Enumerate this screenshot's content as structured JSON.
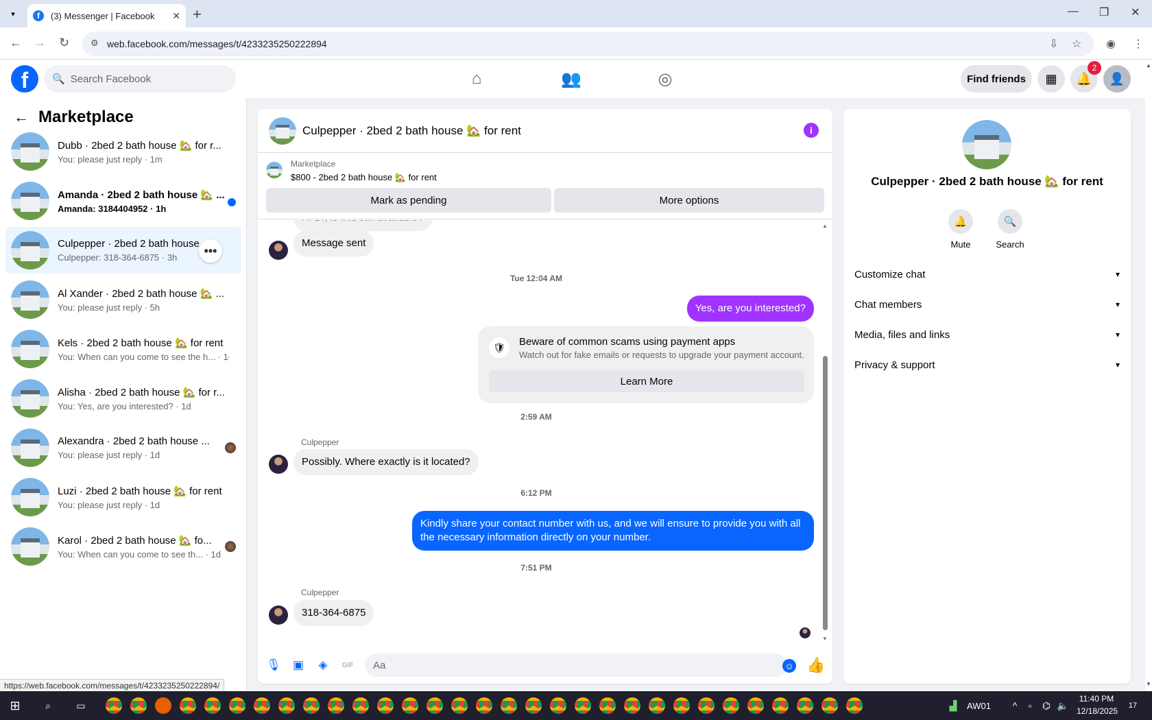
{
  "browser": {
    "tab_title": "(3) Messenger | Facebook",
    "url": "web.facebook.com/messages/t/4233235250222894",
    "status_url": "https://web.facebook.com/messages/t/4233235250222894/"
  },
  "header": {
    "search_placeholder": "Search Facebook",
    "find_friends": "Find friends",
    "notification_count": "2"
  },
  "left": {
    "title": "Marketplace",
    "conversations": [
      {
        "name": "Dubb · 2bed 2 bath house 🏡 for r...",
        "snippet": "You: please just reply · 1m"
      },
      {
        "name": "Amanda · 2bed 2 bath house 🏡 ...",
        "snippet": "Amanda: 3184404952 · 1h"
      },
      {
        "name": "Culpepper · 2bed 2 bath house ...",
        "snippet": "Culpepper: 318-364-6875 · 3h"
      },
      {
        "name": "Al Xander · 2bed 2 bath house 🏡 ...",
        "snippet": "You: please just reply · 5h"
      },
      {
        "name": "Kels · 2bed 2 bath house 🏡 for rent",
        "snippet": "You: When can you come to see the h... · 1d"
      },
      {
        "name": "Alisha · 2bed 2 bath house 🏡 for r...",
        "snippet": "You: Yes, are you interested? · 1d"
      },
      {
        "name": "Alexandra · 2bed 2 bath house ...",
        "snippet": "You: please just reply · 1d"
      },
      {
        "name": "Luzi · 2bed 2 bath house 🏡 for rent",
        "snippet": "You: please just reply · 1d"
      },
      {
        "name": "Karol · 2bed 2 bath house 🏡 fo...",
        "snippet": "You: When can you come to see th... · 1d"
      }
    ]
  },
  "chat": {
    "title": "Culpepper · 2bed 2 bath house 🏡 for rent",
    "marketplace_label": "Marketplace",
    "listing": "$800 - 2bed 2 bath house 🏡 for rent",
    "mark_pending": "Mark as pending",
    "more_options": "More options",
    "cut_off_msg": "Hi Dr, is this still available?",
    "msg_sent": "Message sent",
    "ts1": "Tue 12:04 AM",
    "out1": "Yes, are you interested?",
    "scam_title": "Beware of common scams using payment apps",
    "scam_sub": "Watch out for fake emails or requests to upgrade your payment account.",
    "learn_more": "Learn More",
    "ts2": "2:59 AM",
    "sender": "Culpepper",
    "in1": "Possibly. Where exactly is it located?",
    "ts3": "6:12 PM",
    "out2": "Kindly share your contact number with us, and we will ensure to provide you with all the necessary information directly on your number.",
    "ts4": "7:51 PM",
    "in2": "318-364-6875",
    "composer_placeholder": "Aa"
  },
  "info": {
    "title": "Culpepper · 2bed 2 bath house 🏡 for rent",
    "mute": "Mute",
    "search": "Search",
    "rows": [
      "Customize chat",
      "Chat members",
      "Media, files and links",
      "Privacy & support"
    ]
  },
  "taskbar": {
    "label": "AW01",
    "time": "11:40 PM",
    "date": "12/18/2025",
    "notif": "17"
  }
}
